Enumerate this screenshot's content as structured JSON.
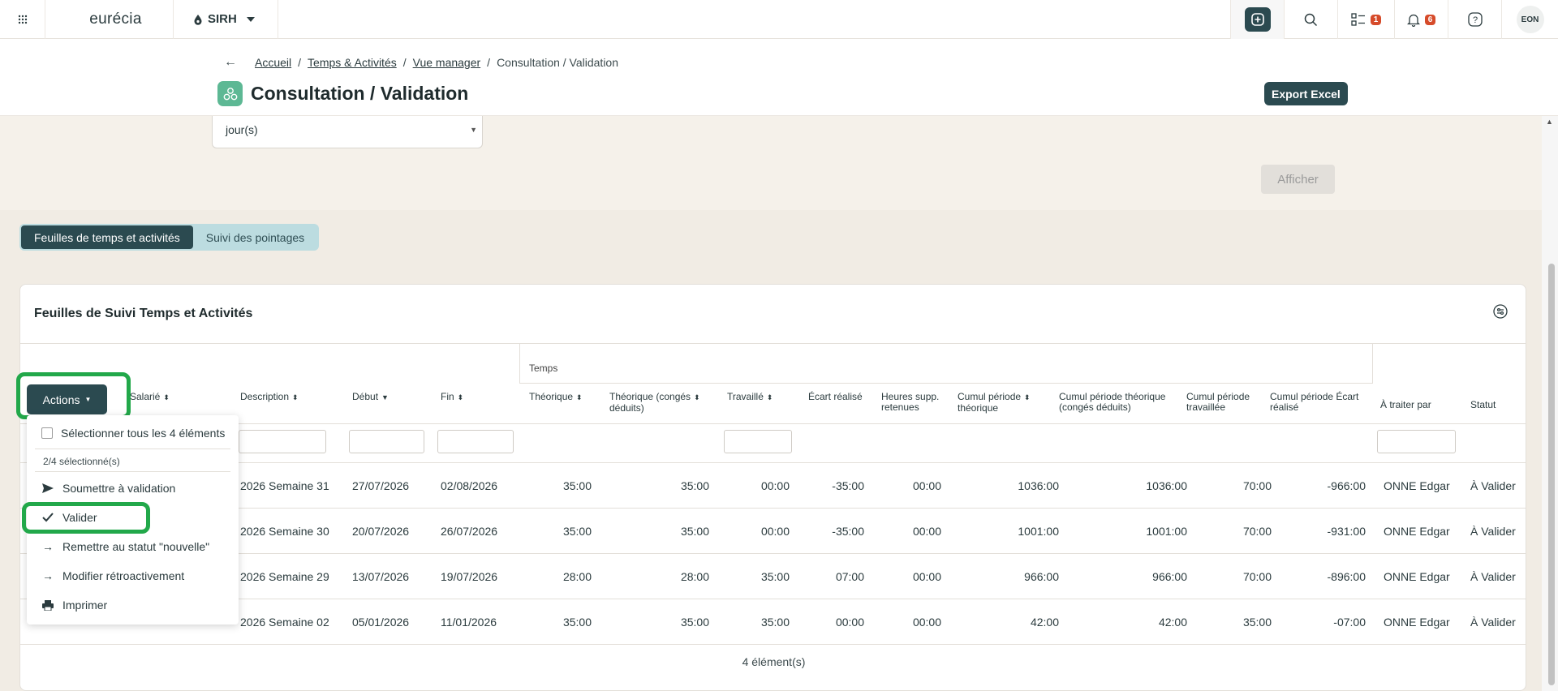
{
  "topbar": {
    "logo": "eurécia",
    "module": "SIRH",
    "badges": {
      "tasks": "1",
      "notifications": "6"
    },
    "avatar": "EON"
  },
  "breadcrumb": {
    "items": [
      "Accueil",
      "Temps & Activités",
      "Vue manager"
    ],
    "current": "Consultation / Validation"
  },
  "page": {
    "title": "Consultation / Validation",
    "export_label": "Export Excel"
  },
  "filters": {
    "period_unit": "jour(s)",
    "submit_label": "Afficher"
  },
  "tabs": [
    {
      "label": "Feuilles de temps et activités",
      "active": true
    },
    {
      "label": "Suivi des pointages",
      "active": false
    }
  ],
  "table": {
    "title": "Feuilles de Suivi Temps et Activités",
    "group_temps": "Temps",
    "headers": {
      "salarie": "Salarié",
      "description": "Description",
      "debut": "Début",
      "fin": "Fin",
      "theorique": "Théorique",
      "theorique_conges_1": "Théorique (congés",
      "theorique_conges_2": "déduits)",
      "travaille": "Travaillé",
      "ecart": "Écart réalisé",
      "heures_supp_1": "Heures supp.",
      "heures_supp_2": "retenues",
      "cumul_theo_1": "Cumul période",
      "cumul_theo_2": "théorique",
      "cumul_theo_conges_1": "Cumul période théorique",
      "cumul_theo_conges_2": "(congés déduits)",
      "cumul_trav_1": "Cumul période",
      "cumul_trav_2": "travaillée",
      "cumul_ecart_1": "Cumul période Écart",
      "cumul_ecart_2": "réalisé",
      "a_traiter": "À traiter par",
      "statut": "Statut"
    },
    "rows": [
      {
        "description": "2026 Semaine 31",
        "debut": "27/07/2026",
        "fin": "02/08/2026",
        "theorique": "35:00",
        "theorique_conges": "35:00",
        "travaille": "00:00",
        "ecart": "-35:00",
        "heures_supp": "00:00",
        "cumul_theo": "1036:00",
        "cumul_theo_conges": "1036:00",
        "cumul_trav": "70:00",
        "cumul_ecart": "-966:00",
        "a_traiter": "ONNE Edgar",
        "statut": "À Valider"
      },
      {
        "description": "2026 Semaine 30",
        "debut": "20/07/2026",
        "fin": "26/07/2026",
        "theorique": "35:00",
        "theorique_conges": "35:00",
        "travaille": "00:00",
        "ecart": "-35:00",
        "heures_supp": "00:00",
        "cumul_theo": "1001:00",
        "cumul_theo_conges": "1001:00",
        "cumul_trav": "70:00",
        "cumul_ecart": "-931:00",
        "a_traiter": "ONNE Edgar",
        "statut": "À Valider"
      },
      {
        "description": "2026 Semaine 29",
        "debut": "13/07/2026",
        "fin": "19/07/2026",
        "theorique": "28:00",
        "theorique_conges": "28:00",
        "travaille": "35:00",
        "ecart": "07:00",
        "heures_supp": "00:00",
        "cumul_theo": "966:00",
        "cumul_theo_conges": "966:00",
        "cumul_trav": "70:00",
        "cumul_ecart": "-896:00",
        "a_traiter": "ONNE Edgar",
        "statut": "À Valider"
      },
      {
        "description": "2026 Semaine 02",
        "debut": "05/01/2026",
        "fin": "11/01/2026",
        "theorique": "35:00",
        "theorique_conges": "35:00",
        "travaille": "35:00",
        "ecart": "00:00",
        "heures_supp": "00:00",
        "cumul_theo": "42:00",
        "cumul_theo_conges": "42:00",
        "cumul_trav": "35:00",
        "cumul_ecart": "-07:00",
        "a_traiter": "ONNE Edgar",
        "statut": "À Valider"
      }
    ],
    "footer_count": "4 élément(s)"
  },
  "actions_menu": {
    "button_label": "Actions",
    "select_all": "Sélectionner tous les 4 éléments",
    "selected_count": "2/4 sélectionné(s)",
    "items": [
      {
        "label": "Soumettre à validation",
        "icon": "send-icon"
      },
      {
        "label": "Valider",
        "icon": "check-icon"
      },
      {
        "label": "Remettre au statut \"nouvelle\"",
        "icon": "arrow-right-icon"
      },
      {
        "label": "Modifier rétroactivement",
        "icon": "arrow-right-icon"
      },
      {
        "label": "Imprimer",
        "icon": "printer-icon"
      }
    ]
  },
  "colors": {
    "primary": "#2b4a50",
    "highlight": "#22a84a",
    "badge": "#d64b2a",
    "tab_bg": "#bcdce0"
  }
}
